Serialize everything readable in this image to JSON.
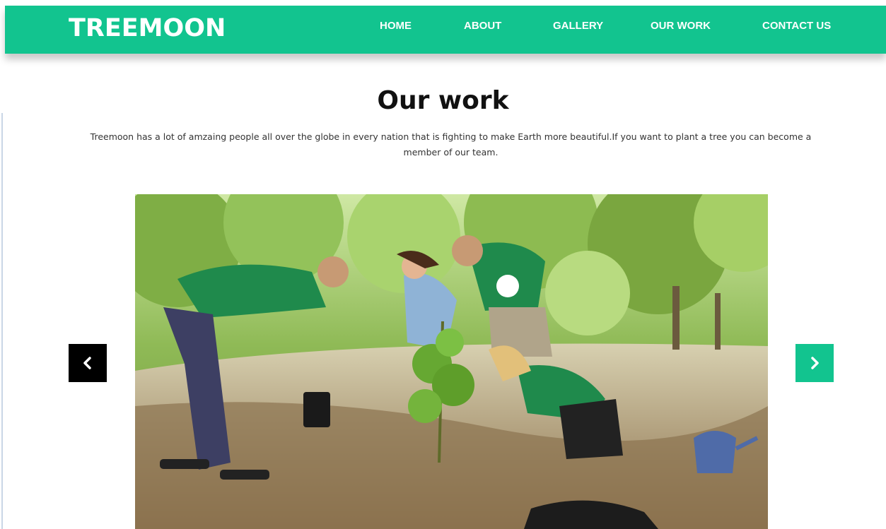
{
  "brand": "TREEMOON",
  "nav": {
    "items": [
      {
        "label": "HOME"
      },
      {
        "label": "ABOUT"
      },
      {
        "label": "GALLERY"
      },
      {
        "label": "OUR WORK"
      },
      {
        "label": "CONTACT US"
      }
    ]
  },
  "section": {
    "title": "Our work",
    "intro": "Treemoon has a lot of amzaing people all over the globe in every nation that is fighting to make Earth more beautiful.If you want to plant a tree you can become a member of our team."
  },
  "carousel": {
    "image_description": "Volunteers in green t-shirts planting a young tree in a park",
    "prev_icon": "chevron-left-icon",
    "next_icon": "chevron-right-icon"
  },
  "colors": {
    "accent": "#12c48f",
    "prev_button": "#000000",
    "text_dark": "#111111"
  }
}
